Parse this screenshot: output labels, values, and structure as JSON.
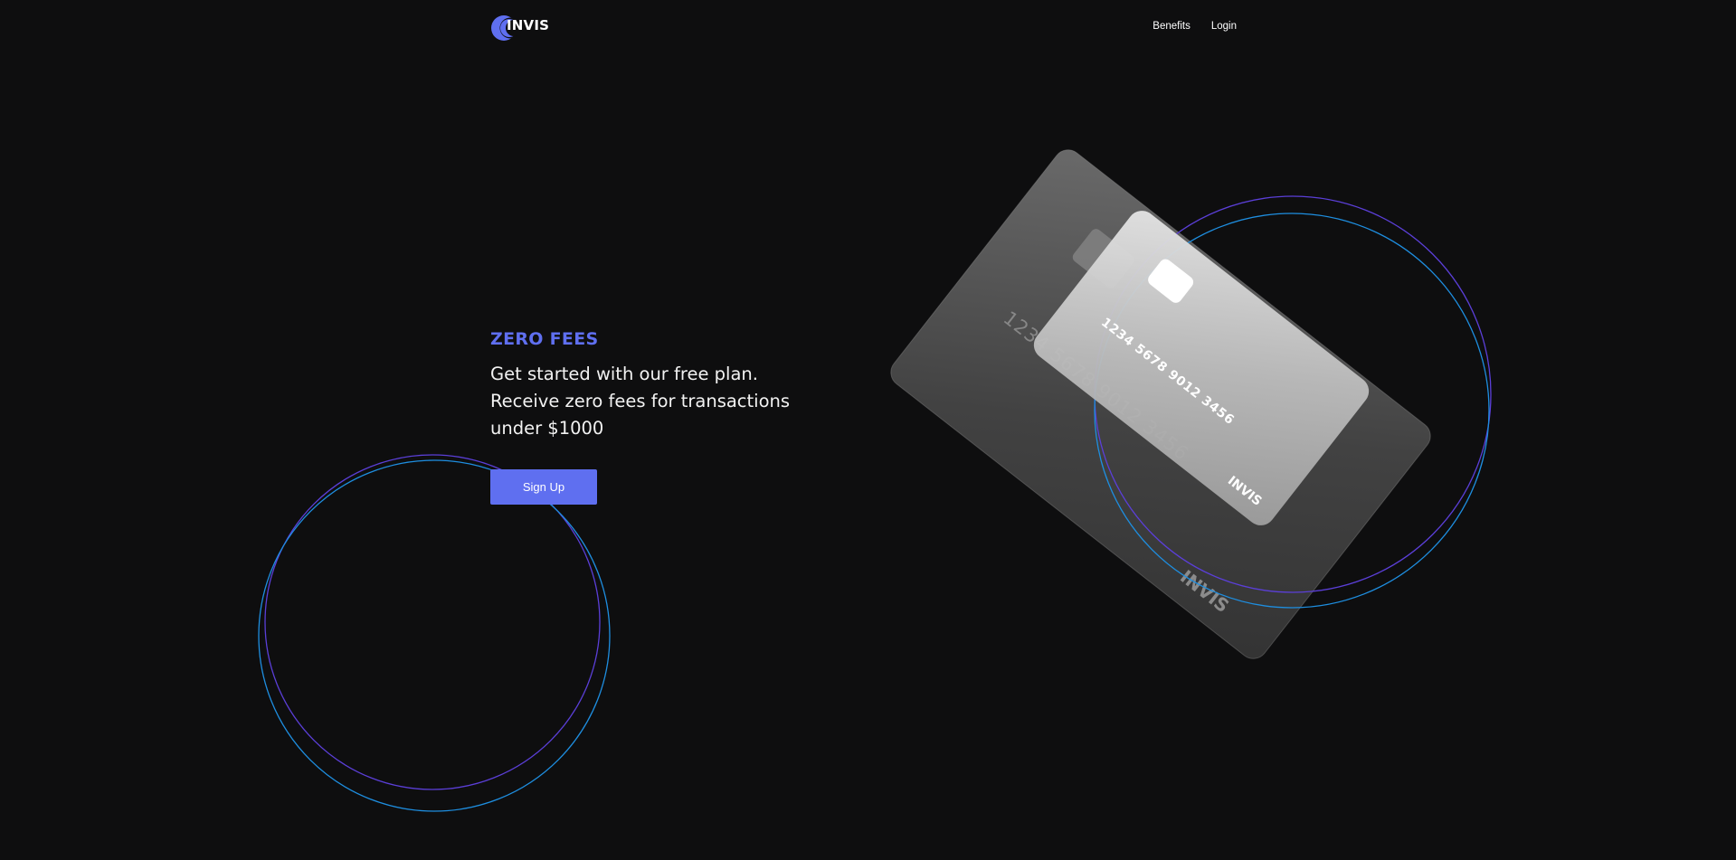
{
  "header": {
    "brand": "INVIS",
    "nav": {
      "benefits": "Benefits",
      "login": "Login"
    }
  },
  "hero": {
    "kicker": "ZERO FEES",
    "body": "Get started with our free plan. Receive zero fees for transactions under $1000",
    "signup_label": "Sign Up"
  },
  "cards": {
    "back_card": {
      "number": "1234 5678 9012 3456",
      "brand": "INVIS"
    },
    "front_card": {
      "number": "1234 5678 9012 3456",
      "brand": "INVIS"
    }
  },
  "theme": {
    "background": "#0e0e0f",
    "accent": "#5f6ff0",
    "ring_purple": "#5b3fd8",
    "ring_blue": "#1e8ee0"
  }
}
